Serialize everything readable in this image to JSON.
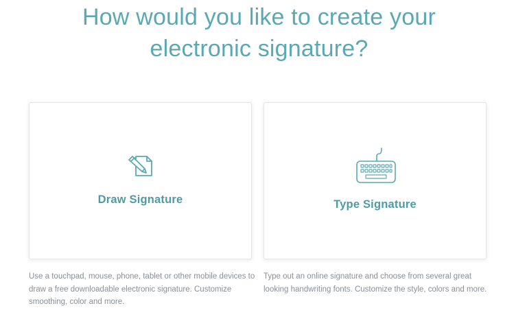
{
  "heading": {
    "line1": "How would you like to create your",
    "line2": "electronic signature?"
  },
  "options": {
    "draw": {
      "title": "Draw Signature",
      "icon": "pencil-note-icon",
      "description": "Use a touchpad, mouse, phone, tablet or other mobile devices to draw a free downloadable electronic signature. Customize smoothing, color and more."
    },
    "type": {
      "title": "Type Signature",
      "icon": "keyboard-icon",
      "description": "Type out an online signature and choose from several great looking handwriting fonts. Customize the style, colors and more."
    }
  },
  "colors": {
    "accent": "#5aa9b2",
    "card_title": "#4e9ba6",
    "description_text": "#8a8f94",
    "card_border": "#e3e6e8"
  }
}
